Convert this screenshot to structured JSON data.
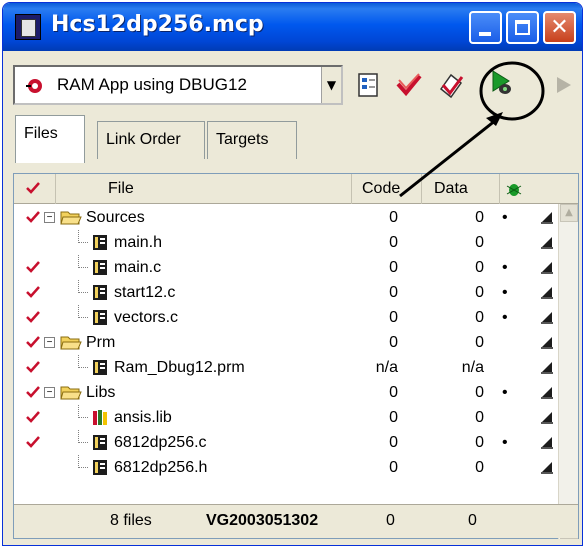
{
  "window": {
    "title": "Hcs12dp256.mcp",
    "controls": {
      "close_glyph": "✕"
    }
  },
  "toolbar": {
    "target_combo": {
      "selected": "RAM App using DBUG12"
    },
    "icons": [
      "target-settings-icon",
      "make-icon",
      "debug-icon",
      "run-icon",
      "arrow-right-icon"
    ]
  },
  "tabs": [
    {
      "label": "Files",
      "active": true
    },
    {
      "label": "Link Order",
      "active": false
    },
    {
      "label": "Targets",
      "active": false
    }
  ],
  "columns": {
    "file": "File",
    "code": "Code",
    "data": "Data"
  },
  "rows": [
    {
      "name": "Sources",
      "type": "folder",
      "checked": true,
      "code": "0",
      "data": "0",
      "dot": "•"
    },
    {
      "name": "main.h",
      "type": "file",
      "checked": false,
      "code": "0",
      "data": "0",
      "dot": ""
    },
    {
      "name": "main.c",
      "type": "file",
      "checked": true,
      "code": "0",
      "data": "0",
      "dot": "•"
    },
    {
      "name": "start12.c",
      "type": "file",
      "checked": true,
      "code": "0",
      "data": "0",
      "dot": "•"
    },
    {
      "name": "vectors.c",
      "type": "file",
      "checked": true,
      "code": "0",
      "data": "0",
      "dot": "•"
    },
    {
      "name": "Prm",
      "type": "folder",
      "checked": true,
      "code": "0",
      "data": "0",
      "dot": ""
    },
    {
      "name": "Ram_Dbug12.prm",
      "type": "file",
      "checked": true,
      "code": "n/a",
      "data": "n/a",
      "dot": ""
    },
    {
      "name": "Libs",
      "type": "folder",
      "checked": true,
      "code": "0",
      "data": "0",
      "dot": "•"
    },
    {
      "name": "ansis.lib",
      "type": "lib",
      "checked": true,
      "code": "0",
      "data": "0",
      "dot": ""
    },
    {
      "name": "6812dp256.c",
      "type": "file",
      "checked": true,
      "code": "0",
      "data": "0",
      "dot": "•"
    },
    {
      "name": "6812dp256.h",
      "type": "file",
      "checked": false,
      "code": "0",
      "data": "0",
      "dot": ""
    }
  ],
  "status": {
    "files": "8 files",
    "version": "VG2003051302",
    "code_total": "0",
    "data_total": "0"
  },
  "colors": {
    "titlebar": "#0058ee",
    "window_face": "#ece9d8",
    "check_red": "#c8102e",
    "folder_yellow": "#f2d15c"
  }
}
